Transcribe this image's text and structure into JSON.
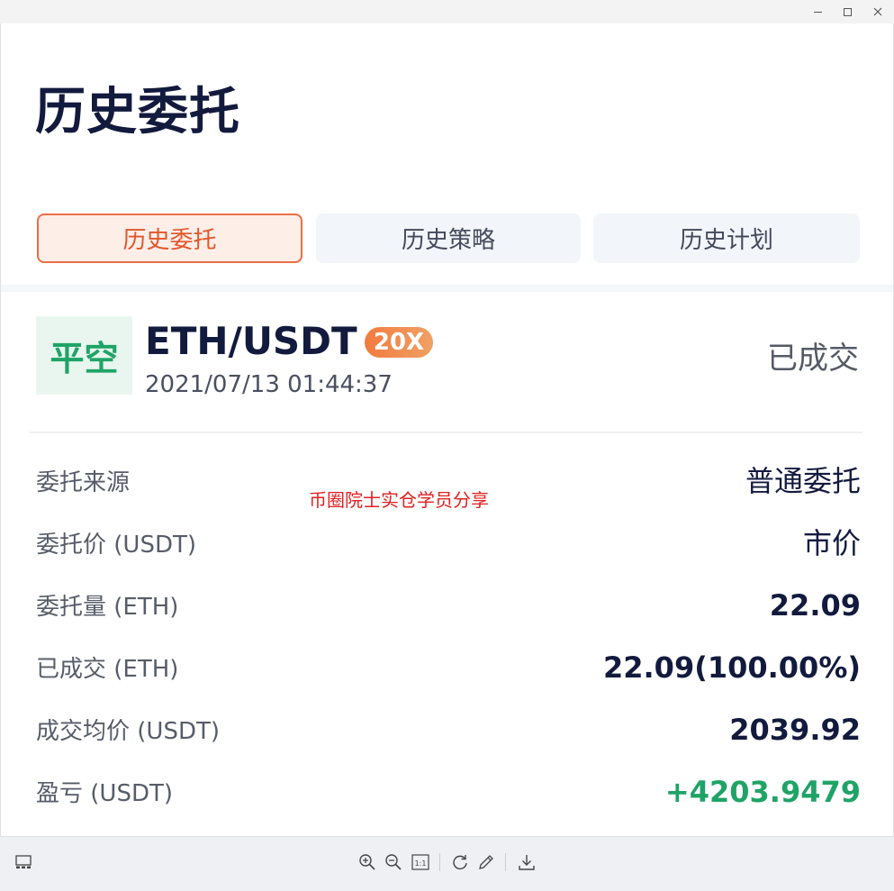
{
  "window": {
    "controls": [
      "minimize-icon",
      "maximize-icon",
      "close-icon"
    ]
  },
  "page": {
    "title": "历史委托"
  },
  "tabs": [
    {
      "label": "历史委托",
      "active": true
    },
    {
      "label": "历史策略",
      "active": false
    },
    {
      "label": "历史计划",
      "active": false
    }
  ],
  "order": {
    "action": "平空",
    "pair": "ETH/USDT",
    "leverage": "20X",
    "timestamp": "2021/07/13 01:44:37",
    "status": "已成交"
  },
  "details": [
    {
      "label": "委托来源",
      "value": "普通委托"
    },
    {
      "label": "委托价 (USDT)",
      "value": "市价"
    },
    {
      "label": "委托量 (ETH)",
      "value": "22.09"
    },
    {
      "label": "已成交 (ETH)",
      "value": "22.09(100.00%)"
    },
    {
      "label": "成交均价 (USDT)",
      "value": "2039.92"
    },
    {
      "label": "盈亏 (USDT)",
      "value": "+4203.9479"
    }
  ],
  "watermark": "币圈院士实仓学员分享",
  "colors": {
    "accent": "#ec6e45",
    "profit": "#1fa367",
    "title": "#121a3d"
  },
  "toolbar": {
    "icons": [
      "thumbnail-icon",
      "zoom-in-icon",
      "zoom-out-icon",
      "actual-size-icon",
      "rotate-icon",
      "edit-icon",
      "download-icon"
    ],
    "actual_size_label": "1:1"
  }
}
